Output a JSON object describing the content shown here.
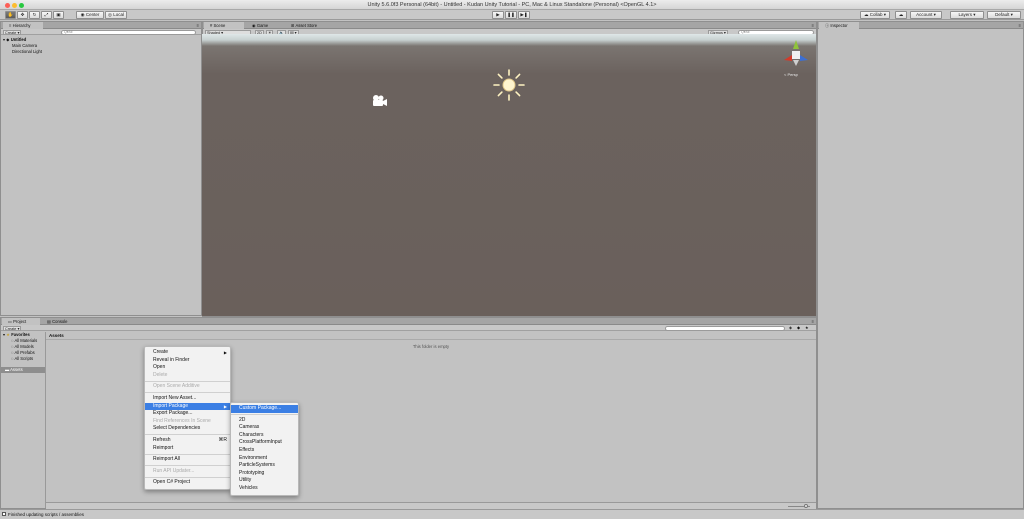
{
  "window": {
    "title": "Unity 5.6.0f3 Personal (64bit) - Untitled - Kudan Unity Tutorial - PC, Mac & Linux Standalone (Personal) <OpenGL 4.1>"
  },
  "colors": {
    "close": "#fc5f57",
    "minimize": "#fdbc2e",
    "zoom": "#28c840",
    "highlight": "#3b7fe4",
    "scene_ground": "#6a605b"
  },
  "toolbar": {
    "tools": [
      "hand-icon",
      "move-icon",
      "rotate-icon",
      "scale-icon",
      "rect-icon"
    ],
    "pivot": "Center",
    "space": "Local",
    "play": "▶",
    "pause": "❚❚",
    "step": "▶❚",
    "collab": "Collab",
    "account": "Account",
    "layers": "Layers",
    "layout": "Default"
  },
  "hierarchy": {
    "tab": "Hierarchy",
    "create": "Create",
    "search_placeholder": "Q▾All",
    "scene": "Untitled",
    "items": [
      "Main Camera",
      "Directional Light"
    ]
  },
  "scene_view": {
    "tabs": [
      "Scene",
      "Game",
      "Asset Store"
    ],
    "shading": "Shaded",
    "mode_2d": "2D",
    "gizmos": "Gizmos",
    "search_placeholder": "Q▾All",
    "persp": "< Persp"
  },
  "inspector": {
    "tab": "Inspector"
  },
  "project": {
    "tabs": [
      "Project",
      "Console"
    ],
    "create": "Create",
    "favorites": "Favorites",
    "favorite_items": [
      "All Materials",
      "All Models",
      "All Prefabs",
      "All Scripts"
    ],
    "assets": "Assets",
    "path": "Assets",
    "empty_msg": "This folder is empty"
  },
  "context_menu": {
    "items": [
      {
        "label": "Create",
        "type": "submenu"
      },
      {
        "label": "Reveal in Finder"
      },
      {
        "label": "Open"
      },
      {
        "label": "Delete",
        "type": "disabled"
      },
      {
        "type": "sep"
      },
      {
        "label": "Open Scene Additive",
        "type": "disabled"
      },
      {
        "type": "sep"
      },
      {
        "label": "Import New Asset..."
      },
      {
        "label": "Import Package",
        "type": "highlight"
      },
      {
        "label": "Export Package..."
      },
      {
        "label": "Find References In Scene",
        "type": "disabled"
      },
      {
        "label": "Select Dependencies"
      },
      {
        "type": "sep"
      },
      {
        "label": "Refresh",
        "shortcut": "⌘R"
      },
      {
        "label": "Reimport"
      },
      {
        "type": "sep"
      },
      {
        "label": "Reimport All"
      },
      {
        "type": "sep"
      },
      {
        "label": "Run API Updater...",
        "type": "disabled"
      },
      {
        "type": "sep"
      },
      {
        "label": "Open C# Project"
      }
    ]
  },
  "submenu": {
    "items": [
      {
        "label": "Custom Package...",
        "type": "highlight"
      },
      {
        "type": "sep"
      },
      {
        "label": "2D"
      },
      {
        "label": "Cameras"
      },
      {
        "label": "Characters"
      },
      {
        "label": "CrossPlatformInput"
      },
      {
        "label": "Effects"
      },
      {
        "label": "Environment"
      },
      {
        "label": "ParticleSystems"
      },
      {
        "label": "Prototyping"
      },
      {
        "label": "Utility"
      },
      {
        "label": "Vehicles"
      }
    ]
  },
  "status": {
    "text": "Finished updating scripts / assemblies"
  }
}
